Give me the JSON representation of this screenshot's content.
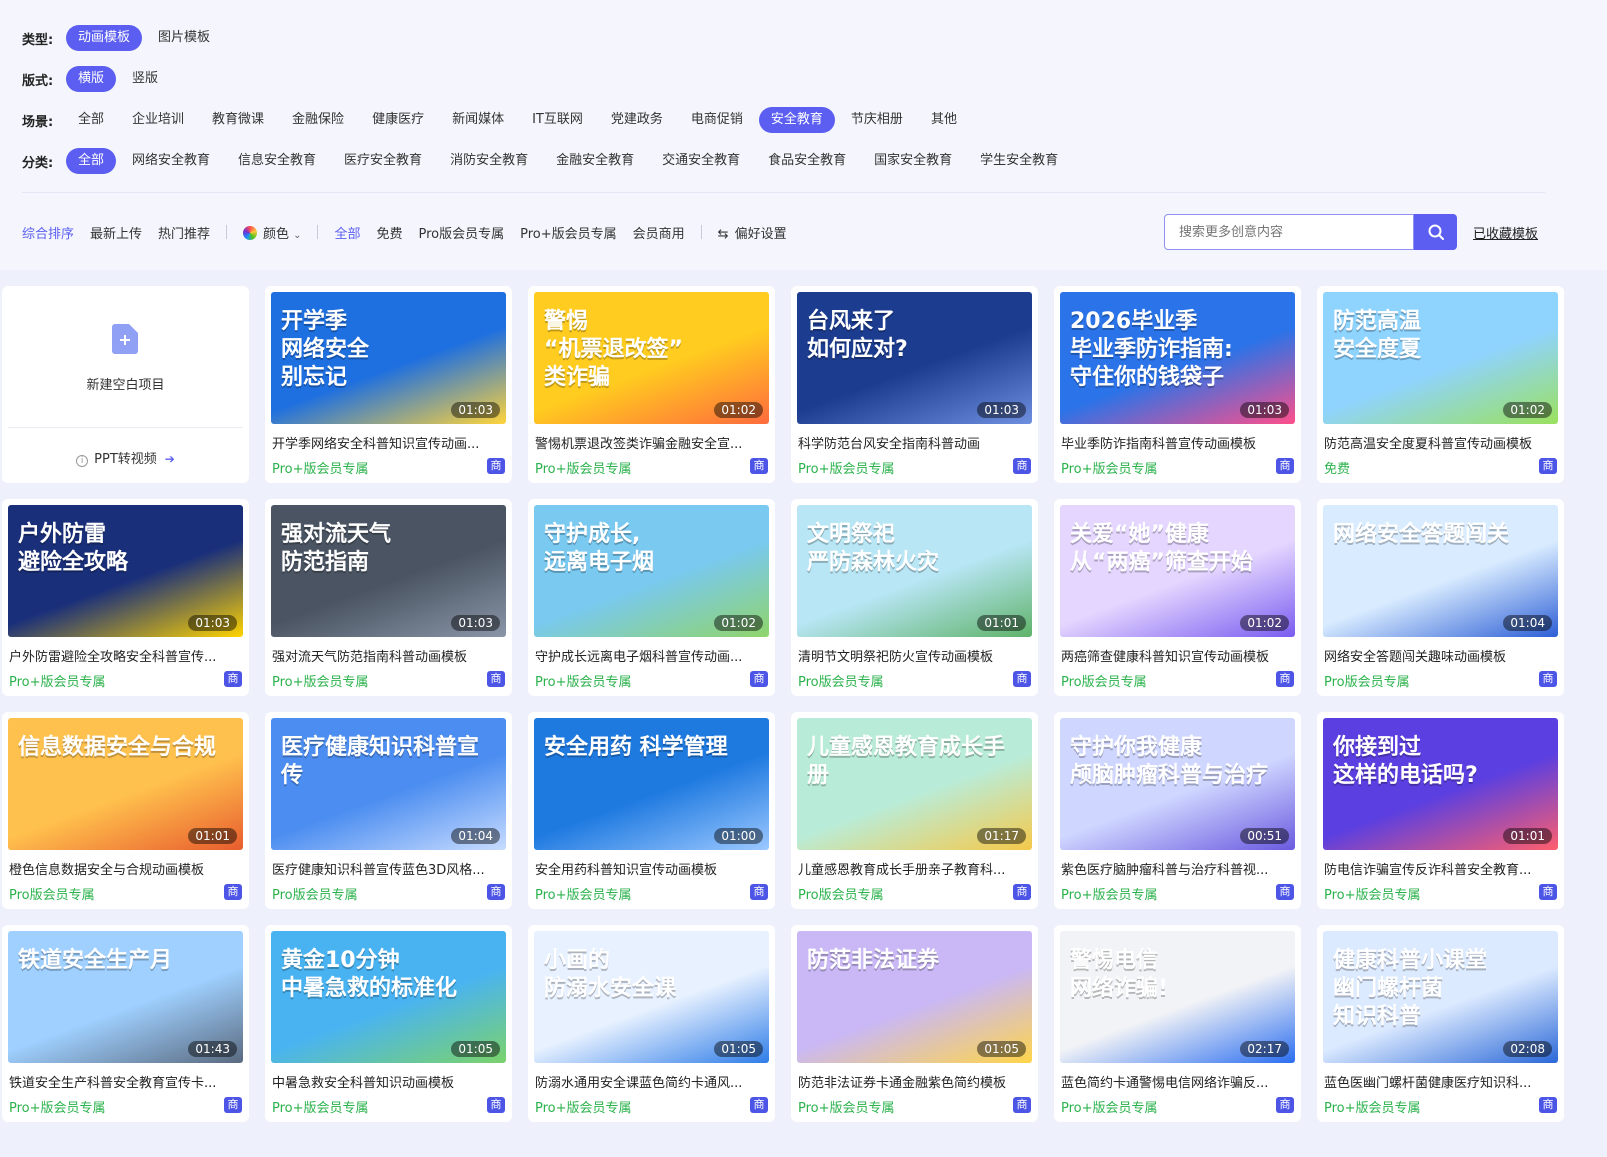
{
  "filters": {
    "type": {
      "label": "类型:",
      "options": [
        "动画模板",
        "图片模板"
      ],
      "active": 0
    },
    "layout": {
      "label": "版式:",
      "options": [
        "横版",
        "竖版"
      ],
      "active": 0
    },
    "scene": {
      "label": "场景:",
      "options": [
        "全部",
        "企业培训",
        "教育微课",
        "金融保险",
        "健康医疗",
        "新闻媒体",
        "IT互联网",
        "党建政务",
        "电商促销",
        "安全教育",
        "节庆相册",
        "其他"
      ],
      "active": 9
    },
    "category": {
      "label": "分类:",
      "options": [
        "全部",
        "网络安全教育",
        "信息安全教育",
        "医疗安全教育",
        "消防安全教育",
        "金融安全教育",
        "交通安全教育",
        "食品安全教育",
        "国家安全教育",
        "学生安全教育"
      ],
      "active": 0
    }
  },
  "sort": {
    "items": [
      "综合排序",
      "最新上传",
      "热门推荐"
    ],
    "color_label": "颜色",
    "price": [
      "全部",
      "免费",
      "Pro版会员专属",
      "Pro+版会员专属",
      "会员商用"
    ],
    "pref_label": "偏好设置"
  },
  "search": {
    "placeholder": "搜索更多创意内容"
  },
  "favorites_label": "已收藏模板",
  "blank": {
    "label": "新建空白项目",
    "ppt_label": "PPT转视频"
  },
  "badge_label": "商",
  "cards": [
    {
      "title": "开学季网络安全科普知识宣传动画...",
      "tier": "Pro+版会员专属",
      "duration": "01:03",
      "thumb_text": "开学季\n网络安全\n别忘记",
      "bg": "#1e6fe0",
      "bg2": "#ffd43b"
    },
    {
      "title": "警惕机票退改签类诈骗金融安全宣...",
      "tier": "Pro+版会员专属",
      "duration": "01:02",
      "thumb_text": "警惕\n“机票退改签”\n类诈骗",
      "bg": "#ffcc1f",
      "bg2": "#ff6b3d"
    },
    {
      "title": "科学防范台风安全指南科普动画",
      "tier": "Pro+版会员专属",
      "duration": "01:03",
      "thumb_text": "台风来了\n如何应对?",
      "bg": "#1c3c8f",
      "bg2": "#6e8fe0"
    },
    {
      "title": "毕业季防诈指南科普宣传动画模板",
      "tier": "Pro+版会员专属",
      "duration": "01:03",
      "thumb_text": "2026毕业季\n毕业季防诈指南:\n守住你的钱袋子",
      "bg": "#2a73e8",
      "bg2": "#ff4f8b"
    },
    {
      "title": "防范高温安全度夏科普宣传动画模板",
      "tier": "免费",
      "duration": "01:02",
      "thumb_text": "防范高温\n安全度夏",
      "bg": "#8fd3ff",
      "bg2": "#9be15d"
    },
    {
      "title": "户外防雷避险全攻略安全科普宣传...",
      "tier": "Pro+版会员专属",
      "duration": "01:03",
      "thumb_text": "户外防雷\n避险全攻略",
      "bg": "#1a2f7a",
      "bg2": "#ffd400"
    },
    {
      "title": "强对流天气防范指南科普动画模板",
      "tier": "Pro+版会员专属",
      "duration": "01:03",
      "thumb_text": "强对流天气\n防范指南",
      "bg": "#4a5462",
      "bg2": "#8a96a8"
    },
    {
      "title": "守护成长远离电子烟科普宣传动画...",
      "tier": "Pro+版会员专属",
      "duration": "01:02",
      "thumb_text": "守护成长,\n远离电子烟",
      "bg": "#79c9f0",
      "bg2": "#8fd46b"
    },
    {
      "title": "清明节文明祭祀防火宣传动画模板",
      "tier": "Pro版会员专属",
      "duration": "01:01",
      "thumb_text": "文明祭祀\n严防森林火灾",
      "bg": "#b8e6f5",
      "bg2": "#5fb36a"
    },
    {
      "title": "两癌筛查健康科普知识宣传动画模板",
      "tier": "Pro版会员专属",
      "duration": "01:02",
      "thumb_text": "关爱“她”健康\n从“两癌”筛查开始",
      "bg": "#e4d6ff",
      "bg2": "#7a5cf0"
    },
    {
      "title": "网络安全答题闯关趣味动画模板",
      "tier": "Pro版会员专属",
      "duration": "01:04",
      "thumb_text": "网络安全答题闯关",
      "bg": "#d9ecff",
      "bg2": "#2d5fd6"
    },
    {
      "title": "橙色信息数据安全与合规动画模板",
      "tier": "Pro版会员专属",
      "duration": "01:01",
      "thumb_text": "信息数据安全与合规",
      "bg": "#ffc14d",
      "bg2": "#e85d2e"
    },
    {
      "title": "医疗健康知识科普宣传蓝色3D风格...",
      "tier": "Pro版会员专属",
      "duration": "01:04",
      "thumb_text": "医疗健康知识科普宣传",
      "bg": "#4b8df0",
      "bg2": "#c8dcff"
    },
    {
      "title": "安全用药科普知识宣传动画模板",
      "tier": "Pro+版会员专属",
      "duration": "01:00",
      "thumb_text": "安全用药 科学管理",
      "bg": "#1f7ae0",
      "bg2": "#9cc8ff"
    },
    {
      "title": "儿童感恩教育成长手册亲子教育科...",
      "tier": "Pro版会员专属",
      "duration": "01:17",
      "thumb_text": "儿童感恩教育成长手册",
      "bg": "#b9ecd8",
      "bg2": "#f5c94a"
    },
    {
      "title": "紫色医疗脑肿瘤科普与治疗科普视...",
      "tier": "Pro+版会员专属",
      "duration": "00:51",
      "thumb_text": "守护你我健康\n颅脑肿瘤科普与治疗",
      "bg": "#cfd6ff",
      "bg2": "#6a5ae0"
    },
    {
      "title": "防电信诈骗宣传反诈科普安全教育...",
      "tier": "Pro+版会员专属",
      "duration": "01:01",
      "thumb_text": "你接到过\n这样的电话吗?",
      "bg": "#5b3fe0",
      "bg2": "#ff5f6d"
    },
    {
      "title": "铁道安全生产科普安全教育宣传卡...",
      "tier": "Pro+版会员专属",
      "duration": "01:43",
      "thumb_text": "铁道安全生产月",
      "bg": "#9fd0ff",
      "bg2": "#5a6a80"
    },
    {
      "title": "中暑急救安全科普知识动画模板",
      "tier": "Pro+版会员专属",
      "duration": "01:05",
      "thumb_text": "黄金10分钟\n中暑急救的标准化",
      "bg": "#49b3f2",
      "bg2": "#7bd36b"
    },
    {
      "title": "防溺水通用安全课蓝色简约卡通风...",
      "tier": "Pro+版会员专属",
      "duration": "01:05",
      "thumb_text": "小画的\n防溺水安全课",
      "bg": "#e7f1ff",
      "bg2": "#2f7de8"
    },
    {
      "title": "防范非法证券卡通金融紫色简约模板",
      "tier": "Pro+版会员专属",
      "duration": "01:05",
      "thumb_text": "防范非法证券",
      "bg": "#c9b8f5",
      "bg2": "#ffd54a"
    },
    {
      "title": "蓝色简约卡通警惕电信网络诈骗反...",
      "tier": "Pro+版会员专属",
      "duration": "02:17",
      "thumb_text": "警惕电信\n网络诈骗!",
      "bg": "#f2f3f6",
      "bg2": "#2b6ef0"
    },
    {
      "title": "蓝色医幽门螺杆菌健康医疗知识科...",
      "tier": "Pro+版会员专属",
      "duration": "02:08",
      "thumb_text": "健康科普小课堂\n幽门螺杆菌\n知识科普",
      "bg": "#dceaff",
      "bg2": "#2a68d8"
    }
  ]
}
